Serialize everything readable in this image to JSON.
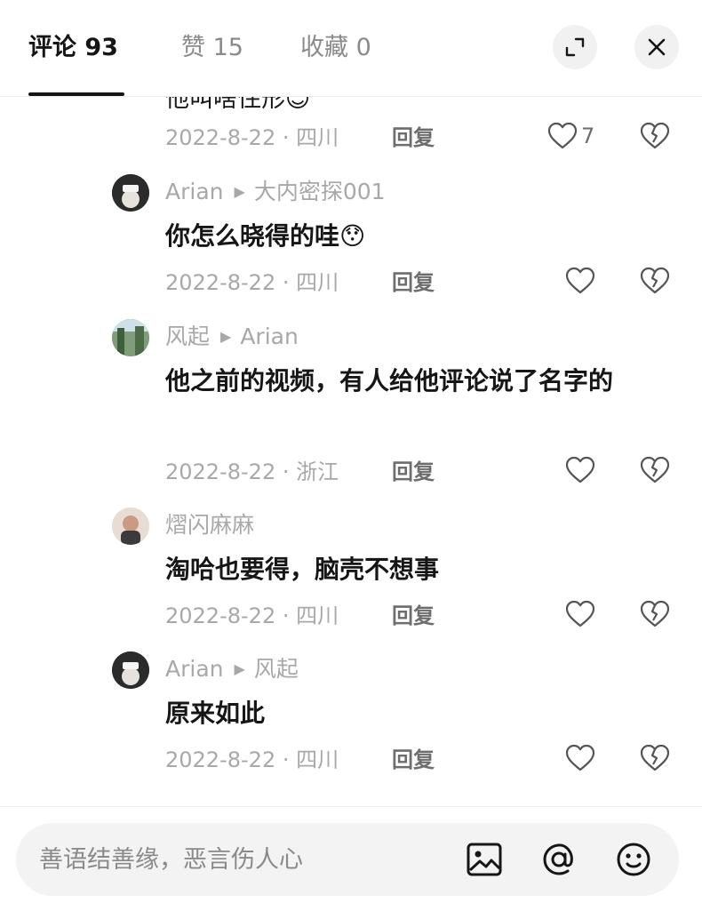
{
  "tabs": [
    {
      "label": "评论 93"
    },
    {
      "label": "赞 15"
    },
    {
      "label": "收藏 0"
    }
  ],
  "cut_text": "他叫啥住形😌",
  "first_meta": {
    "date_location": "2022-8-22 · 四川",
    "reply": "回复",
    "likes": "7"
  },
  "comments": [
    {
      "author": "Arian",
      "reply_to": "大内密探001",
      "content": "你怎么晓得的哇😯",
      "date_location": "2022-8-22 · 四川",
      "reply": "回复"
    },
    {
      "author": "风起",
      "reply_to": "Arian",
      "content": "他之前的视频，有人给他评论说了名字的",
      "date_location": "2022-8-22 · 浙江",
      "reply": "回复"
    },
    {
      "author": "熠闪麻麻",
      "reply_to": "",
      "content": "淘哈也要得，脑壳不想事",
      "date_location": "2022-8-22 · 四川",
      "reply": "回复"
    },
    {
      "author": "Arian",
      "reply_to": "风起",
      "content": "原来如此",
      "date_location": "2022-8-22 · 四川",
      "reply": "回复"
    }
  ],
  "input": {
    "placeholder": "善语结善缘，恶言伤人心"
  },
  "icons": {
    "expand": "expand-icon",
    "close": "close-icon",
    "like": "heart-icon",
    "dislike": "broken-heart-icon",
    "image": "image-icon",
    "mention": "at-icon",
    "emoji": "emoji-icon"
  }
}
